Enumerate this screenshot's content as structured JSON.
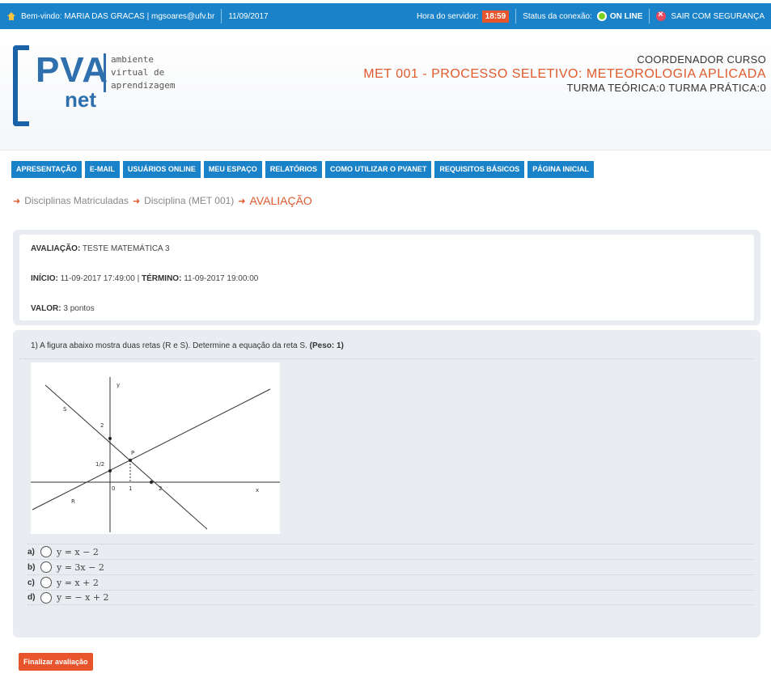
{
  "topbar": {
    "welcome": "Bem-vindo: MARIA DAS GRACAS",
    "email": "mgsoares@ufv.br",
    "date": "11/09/2017",
    "server_time_label": "Hora do servidor:",
    "server_time": "18:59",
    "connection_label": "Status da conexão:",
    "connection_status": "ON LINE",
    "logout": "SAIR COM SEGURANÇA"
  },
  "logo": {
    "brand_top": "PVA",
    "brand_bottom": "net",
    "line1": "ambiente",
    "line2": "virtual de",
    "line3": "aprendizagem"
  },
  "course": {
    "role": "COORDENADOR CURSO",
    "title": "MET 001 - PROCESSO SELETIVO: METEOROLOGIA APLICADA",
    "turma": "TURMA TEÓRICA:0 TURMA PRÁTICA:0"
  },
  "nav": {
    "items": [
      "APRESENTAÇÃO",
      "E-MAIL",
      "USUÁRIOS ONLINE",
      "MEU ESPAÇO",
      "RELATÓRIOS",
      "COMO UTILIZAR O PVANET",
      "REQUISITOS BÁSICOS",
      "PÁGINA INICIAL"
    ]
  },
  "breadcrumb": {
    "item1": "Disciplinas Matriculadas",
    "item2": "Disciplina (MET 001)",
    "current": "AVALIAÇÃO"
  },
  "assessment": {
    "name_label": "AVALIAÇÃO:",
    "name": "TESTE MATEMÁTICA 3",
    "start_label": "INÍCIO:",
    "start": "11-09-2017 17:49:00",
    "end_label": "TÉRMINO:",
    "end": "11-09-2017 19:00:00",
    "value_label": "VALOR:",
    "value": "3 pontos"
  },
  "question": {
    "text": "1) A figura abaixo mostra duas retas (R e S). Determine a equação da reta S.",
    "weight": "(Peso: 1)",
    "figure_labels": {
      "y_axis": "y",
      "x_axis": "x",
      "line_s": "S",
      "line_r": "R",
      "point_p": "P",
      "tick_2_y": "2",
      "tick_half": "1/2",
      "origin": "0",
      "tick_1": "1",
      "tick_2_x": "2"
    },
    "options": [
      {
        "letter": "a)",
        "equation": "y = x − 2"
      },
      {
        "letter": "b)",
        "equation": "y = 3x − 2"
      },
      {
        "letter": "c)",
        "equation": "y = x + 2"
      },
      {
        "letter": "d)",
        "equation": "y = − x + 2"
      }
    ]
  },
  "actions": {
    "finish": "Finalizar avaliação"
  },
  "colors": {
    "primary": "#1a82c8",
    "accent": "#e8542b",
    "online": "#7ed321"
  }
}
